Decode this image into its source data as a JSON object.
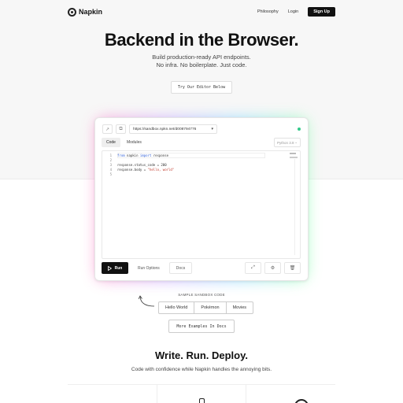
{
  "nav": {
    "logo_text": "Napkin",
    "links": [
      "Philosophy",
      "Login"
    ],
    "signup_label": "Sign Up"
  },
  "hero": {
    "title": "Backend in the Browser.",
    "subtitle_line1": "Build production-ready API endpoints.",
    "subtitle_line2": "No infra. No boilerplate. Just code.",
    "try_button": "Try Our Editor Below"
  },
  "editor": {
    "url": "https://sandbox.npkn.net/d008794776",
    "tabs": [
      "Code",
      "Modules"
    ],
    "active_tab": "Code",
    "language": "Python 3.8",
    "code_lines": [
      {
        "num": "1",
        "parts": [
          {
            "t": "from",
            "c": "kw"
          },
          {
            "t": " napkin ",
            "c": ""
          },
          {
            "t": "import",
            "c": "kw"
          },
          {
            "t": " response",
            "c": ""
          }
        ]
      },
      {
        "num": "2",
        "parts": [
          {
            "t": "",
            "c": ""
          }
        ]
      },
      {
        "num": "3",
        "parts": [
          {
            "t": "response.status_code = 200",
            "c": ""
          }
        ]
      },
      {
        "num": "4",
        "parts": [
          {
            "t": "response.body = ",
            "c": ""
          },
          {
            "t": "\"hello, world\"",
            "c": "str"
          }
        ]
      },
      {
        "num": "5",
        "parts": [
          {
            "t": "",
            "c": ""
          }
        ]
      }
    ],
    "run_label": "Run",
    "run_options_label": "Run Options",
    "docs_label": "Docs",
    "status_color": "#33c98a"
  },
  "samples": {
    "label": "SAMPLE SANDBOX CODE",
    "items": [
      "Hello World",
      "Pokémon",
      "Movies"
    ],
    "more_label": "More Examples In Docs"
  },
  "section": {
    "title": "Write. Run. Deploy.",
    "subtitle": "Code with confidence while Napkin handles the annoying bits."
  }
}
